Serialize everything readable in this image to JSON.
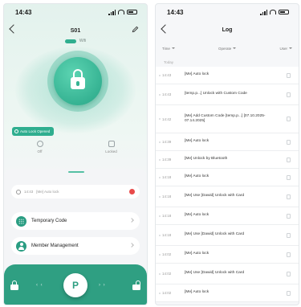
{
  "left_screen": {
    "status": {
      "time": "14:43"
    },
    "header": {
      "title": "S01"
    },
    "wifi_label": "Wifi",
    "autolock_label": "Auto Lock Opened",
    "stats": [
      {
        "label": "Off"
      },
      {
        "label": "Locked"
      }
    ],
    "recent_log": {
      "time": "14:43",
      "text": "[Me]  Auto lock"
    },
    "menu": [
      {
        "label": "Temporary Code"
      },
      {
        "label": "Member Management"
      }
    ],
    "controls": {
      "center_glyph": "P"
    }
  },
  "right_screen": {
    "status": {
      "time": "14:43"
    },
    "header": {
      "title": "Log"
    },
    "filters": [
      {
        "label": "Time"
      },
      {
        "label": "Operate"
      },
      {
        "label": "User"
      }
    ],
    "section_label": "Today",
    "logs": [
      {
        "time": "14:43",
        "text": "[Me]  Auto lock"
      },
      {
        "time": "14:43",
        "text": "[temp.p...]  Unlock with Custom Code"
      },
      {
        "time": "14:42",
        "text": "[Me]  Add Custom Code [temp.p...] [07.10.2025-07.14.2025]"
      },
      {
        "time": "14:39",
        "text": "[Me]  Auto lock"
      },
      {
        "time": "14:39",
        "text": "[Me]  Unlock by Bluetooth"
      },
      {
        "time": "14:18",
        "text": "[Me]  Auto lock"
      },
      {
        "time": "14:18",
        "text": "[Me]  Use [Dawid]  Unlock with Card"
      },
      {
        "time": "14:18",
        "text": "[Me]  Auto lock"
      },
      {
        "time": "14:18",
        "text": "[Me]  Use [Dawid]  Unlock with Card"
      },
      {
        "time": "14:02",
        "text": "[Me]  Auto lock"
      },
      {
        "time": "14:02",
        "text": "[Me]  Use [Dawid]  Unlock with Card"
      },
      {
        "time": "14:02",
        "text": "[Me]  Auto lock"
      }
    ]
  }
}
